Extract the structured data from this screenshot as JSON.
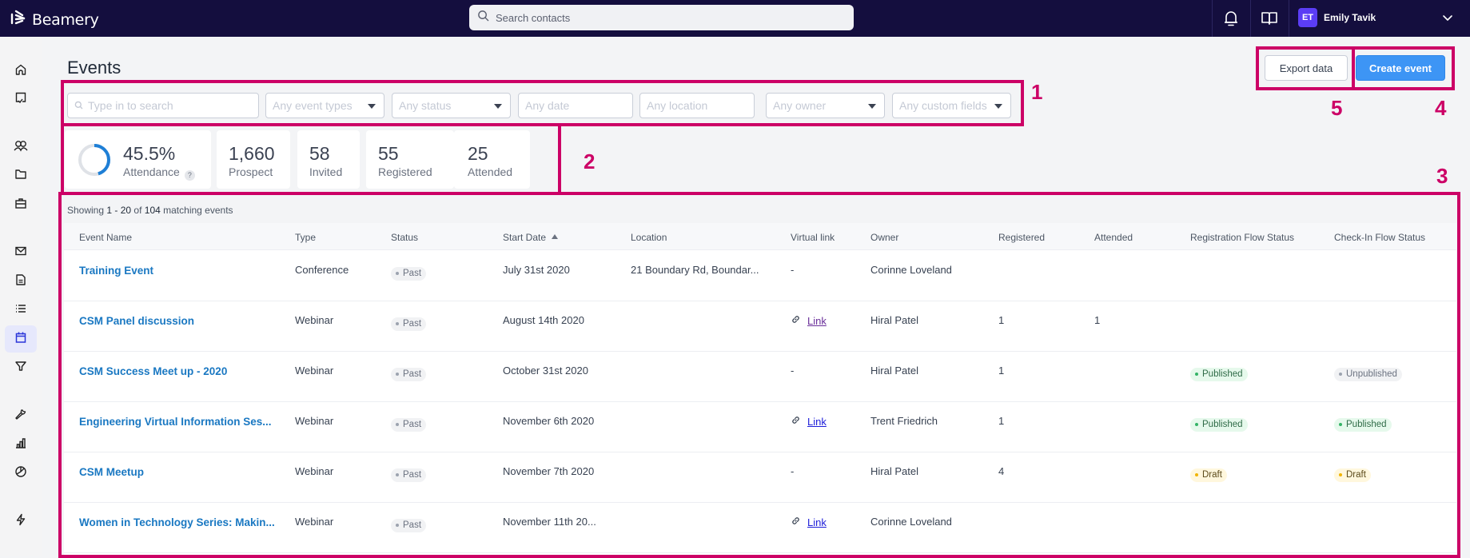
{
  "app": {
    "brand": "Beamery",
    "search_placeholder": "Search contacts",
    "user": {
      "initials": "ET",
      "name": "Emily Tavik"
    }
  },
  "sidebar": {
    "items": [
      {
        "name": "home",
        "icon": "home-icon",
        "active": false
      },
      {
        "name": "tasks",
        "icon": "task-check-icon",
        "active": false
      },
      {
        "name": "contacts",
        "icon": "people-icon",
        "active": false
      },
      {
        "name": "pools",
        "icon": "folder-icon",
        "active": false
      },
      {
        "name": "vacancies",
        "icon": "briefcase-icon",
        "active": false
      },
      {
        "name": "messages",
        "icon": "mail-icon",
        "active": false
      },
      {
        "name": "templates",
        "icon": "document-icon",
        "active": false
      },
      {
        "name": "lists",
        "icon": "list-icon",
        "active": false
      },
      {
        "name": "events",
        "icon": "calendar-icon",
        "active": true
      },
      {
        "name": "pipelines",
        "icon": "filter-icon",
        "active": false
      },
      {
        "name": "tools",
        "icon": "wrench-icon",
        "active": false
      },
      {
        "name": "reports",
        "icon": "bar-chart-icon",
        "active": false
      },
      {
        "name": "analytics",
        "icon": "pie-chart-icon",
        "active": false
      },
      {
        "name": "automations",
        "icon": "lightning-icon",
        "active": false
      }
    ]
  },
  "page": {
    "title": "Events",
    "export_label": "Export data",
    "create_label": "Create event"
  },
  "filters": {
    "search_placeholder": "Type in to search",
    "event_types": "Any event types",
    "status": "Any status",
    "date": "Any date",
    "location": "Any location",
    "owner": "Any owner",
    "custom_fields": "Any custom fields"
  },
  "stats": {
    "attendance": {
      "value": "45.5%",
      "label": "Attendance",
      "fraction": 0.455,
      "help": "?"
    },
    "prospect": {
      "value": "1,660",
      "label": "Prospect"
    },
    "invited": {
      "value": "58",
      "label": "Invited"
    },
    "registered": {
      "value": "55",
      "label": "Registered"
    },
    "attended": {
      "value": "25",
      "label": "Attended"
    }
  },
  "results": {
    "prefix": "Showing",
    "range": "1 - 20",
    "of": "of",
    "total": "104",
    "suffix": "matching events"
  },
  "table": {
    "columns": [
      "Event Name",
      "Type",
      "Status",
      "Start Date",
      "Location",
      "Virtual link",
      "Owner",
      "Registered",
      "Attended",
      "Registration Flow Status",
      "Check-In Flow Status"
    ],
    "sorted_column": "Start Date",
    "rows": [
      {
        "name": "Training Event",
        "type": "Conference",
        "status": "Past",
        "start": "July 31st 2020",
        "location": "21 Boundary Rd, Boundar...",
        "virtual": "-",
        "owner": "Corinne Loveland",
        "registered": "",
        "attended": "",
        "reg_flow": "",
        "checkin_flow": ""
      },
      {
        "name": "CSM Panel discussion",
        "type": "Webinar",
        "status": "Past",
        "start": "August 14th 2020",
        "location": "",
        "virtual": "Link",
        "virtual_visited": true,
        "owner": "Hiral Patel",
        "registered": "1",
        "attended": "1",
        "reg_flow": "",
        "checkin_flow": ""
      },
      {
        "name": "CSM Success Meet up - 2020",
        "type": "Webinar",
        "status": "Past",
        "start": "October 31st 2020",
        "location": "",
        "virtual": "-",
        "owner": "Hiral Patel",
        "registered": "1",
        "attended": "",
        "reg_flow": "Published",
        "checkin_flow": "Unpublished"
      },
      {
        "name": "Engineering Virtual Information Ses...",
        "type": "Webinar",
        "status": "Past",
        "start": "November 6th 2020",
        "location": "",
        "virtual": "Link",
        "virtual_visited": false,
        "owner": "Trent Friedrich",
        "registered": "1",
        "attended": "",
        "reg_flow": "Published",
        "checkin_flow": "Published"
      },
      {
        "name": "CSM Meetup",
        "type": "Webinar",
        "status": "Past",
        "start": "November 7th 2020",
        "location": "",
        "virtual": "-",
        "owner": "Hiral Patel",
        "registered": "4",
        "attended": "",
        "reg_flow": "Draft",
        "checkin_flow": "Draft"
      },
      {
        "name": "Women in Technology Series: Makin...",
        "type": "Webinar",
        "status": "Past",
        "start": "November 11th 20...",
        "location": "",
        "virtual": "Link",
        "virtual_visited": false,
        "owner": "Corinne Loveland",
        "registered": "",
        "attended": "",
        "reg_flow": "",
        "checkin_flow": ""
      }
    ]
  },
  "badge_styles": {
    "Past": {
      "bg": "#f1f2f4",
      "dot": "#9ca3af",
      "fg": "#6b7280"
    },
    "Published": {
      "bg": "#e6f9ec",
      "dot": "#34b366",
      "fg": "#2f6b47"
    },
    "Unpublished": {
      "bg": "#f1f2f4",
      "dot": "#9ca3af",
      "fg": "#6b7280"
    },
    "Draft": {
      "bg": "#fff7dd",
      "dot": "#f0b400",
      "fg": "#5b4a1a"
    }
  },
  "colors": {
    "header_bg": "#140e3e",
    "accent": "#3d95f5",
    "event_link": "#1a78c2",
    "link": "#1d1dd9",
    "link_visited": "#6a2f9a",
    "annotation": "#cc0066"
  },
  "annotations": [
    "1",
    "2",
    "3",
    "4",
    "5"
  ]
}
